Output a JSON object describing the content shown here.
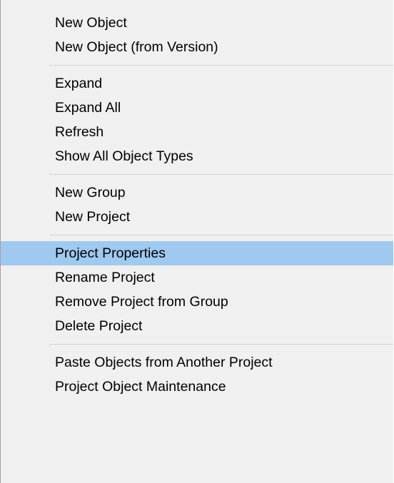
{
  "context_menu": {
    "groups": [
      {
        "items": [
          {
            "label": "New Object"
          },
          {
            "label": "New Object (from Version)"
          }
        ]
      },
      {
        "items": [
          {
            "label": "Expand"
          },
          {
            "label": "Expand All"
          },
          {
            "label": "Refresh"
          },
          {
            "label": "Show All Object Types"
          }
        ]
      },
      {
        "items": [
          {
            "label": "New Group"
          },
          {
            "label": "New Project"
          }
        ]
      },
      {
        "items": [
          {
            "label": "Project Properties",
            "highlighted": true
          },
          {
            "label": "Rename Project"
          },
          {
            "label": "Remove Project from Group"
          },
          {
            "label": "Delete Project"
          }
        ]
      },
      {
        "items": [
          {
            "label": "Paste Objects from Another Project"
          },
          {
            "label": "Project Object Maintenance"
          }
        ]
      }
    ],
    "colors": {
      "background": "#f0f0f0",
      "highlight": "#9fc9ef",
      "separator": "#d3d3d3",
      "text": "#000000"
    }
  }
}
